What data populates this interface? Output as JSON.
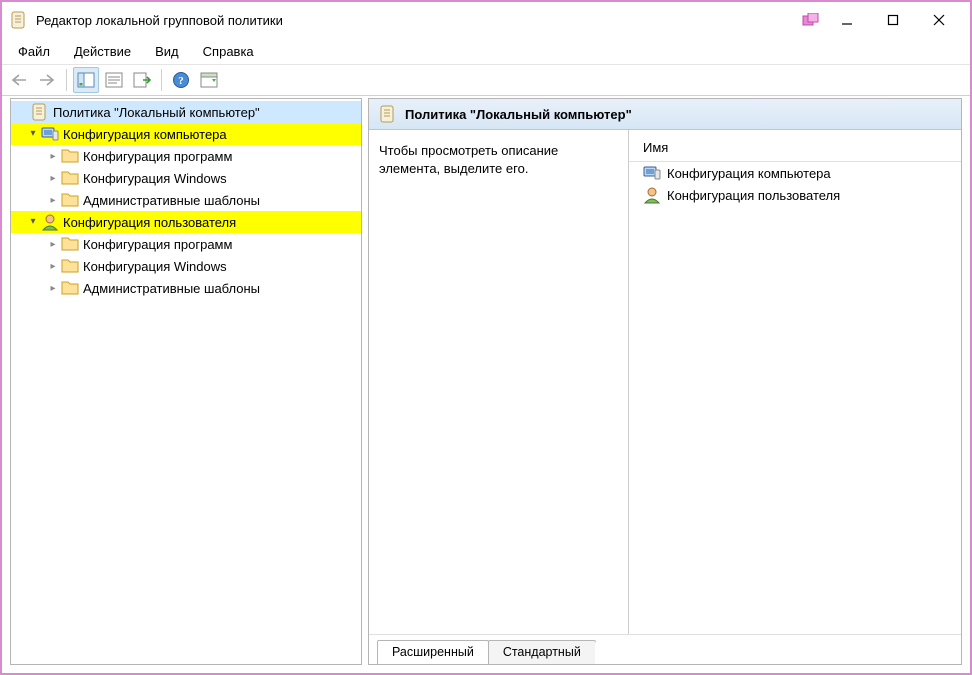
{
  "window": {
    "title": "Редактор локальной групповой политики"
  },
  "menu": {
    "file": "Файл",
    "action": "Действие",
    "view": "Вид",
    "help": "Справка"
  },
  "tree": {
    "root": "Политика \"Локальный компьютер\"",
    "computer_config": "Конфигурация компьютера",
    "user_config": "Конфигурация пользователя",
    "software_settings": "Конфигурация программ",
    "windows_settings": "Конфигурация Windows",
    "admin_templates": "Административные шаблоны"
  },
  "details": {
    "header_title": "Политика \"Локальный компьютер\"",
    "description": "Чтобы просмотреть описание элемента, выделите его.",
    "column_name": "Имя",
    "items": {
      "computer_config": "Конфигурация компьютера",
      "user_config": "Конфигурация пользователя"
    }
  },
  "tabs": {
    "extended": "Расширенный",
    "standard": "Стандартный"
  }
}
